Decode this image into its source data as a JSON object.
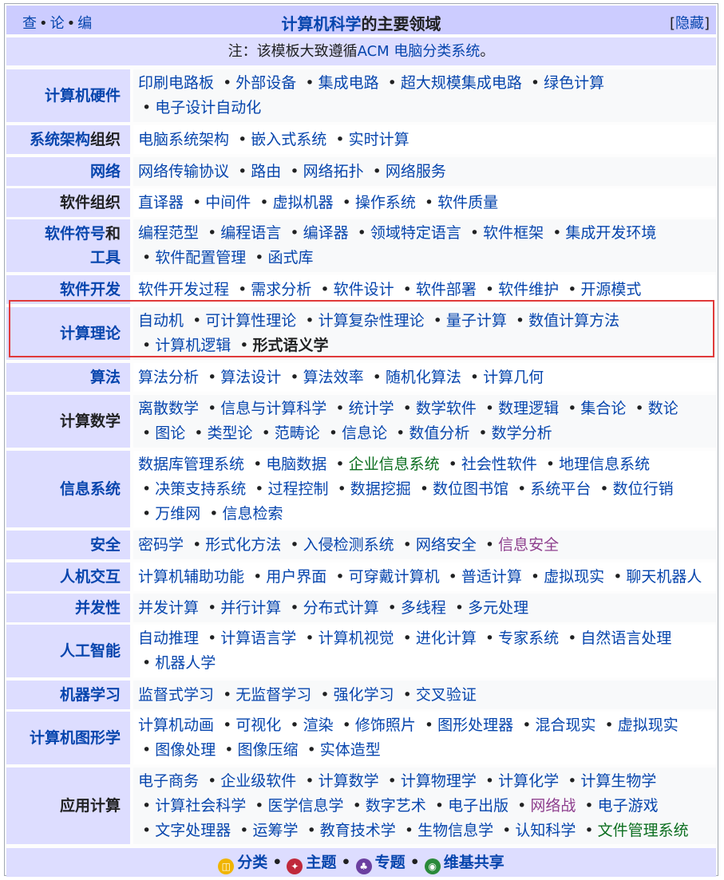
{
  "header": {
    "vte": [
      "查",
      "论",
      "编"
    ],
    "title_link": "计算机科学",
    "title_rest": "的主要领域",
    "hide_open": "[",
    "hide_label": "隐藏",
    "hide_close": "]"
  },
  "note": {
    "prefix": "注：该模板大致遵循",
    "link": "ACM 电脑分类系统",
    "suffix": "。"
  },
  "rows": [
    {
      "group": [
        {
          "t": "计算机硬件",
          "link": true
        }
      ],
      "items": [
        {
          "t": "印刷电路板"
        },
        {
          "t": "外部设备"
        },
        {
          "t": "集成电路"
        },
        {
          "t": "超大规模集成电路"
        },
        {
          "t": "绿色计算"
        },
        {
          "t": "电子设计自动化"
        }
      ]
    },
    {
      "group": [
        {
          "t": "系统架构",
          "link": true
        },
        {
          "t": "组织",
          "link": false
        }
      ],
      "items": [
        {
          "t": "电脑系统架构"
        },
        {
          "t": "嵌入式系统"
        },
        {
          "t": "实时计算"
        }
      ]
    },
    {
      "group": [
        {
          "t": "网络",
          "link": true
        }
      ],
      "items": [
        {
          "t": "网络传输协议"
        },
        {
          "t": "路由"
        },
        {
          "t": "网络拓扑"
        },
        {
          "t": "网络服务"
        }
      ]
    },
    {
      "group": [
        {
          "t": "软件组织",
          "link": false
        }
      ],
      "items": [
        {
          "t": "直译器"
        },
        {
          "t": "中间件"
        },
        {
          "t": "虚拟机器"
        },
        {
          "t": "操作系统"
        },
        {
          "t": "软件质量"
        }
      ]
    },
    {
      "group": [
        {
          "t": "软件符号",
          "link": true
        },
        {
          "t": "和",
          "link": false
        },
        {
          "t": "工具",
          "link": true
        }
      ],
      "items": [
        {
          "t": "编程范型"
        },
        {
          "t": "编程语言"
        },
        {
          "t": "编译器"
        },
        {
          "t": "领域特定语言"
        },
        {
          "t": "软件框架"
        },
        {
          "t": "集成开发环境"
        },
        {
          "t": "软件配置管理"
        },
        {
          "t": "函式库"
        }
      ]
    },
    {
      "group": [
        {
          "t": "软件开发",
          "link": true
        }
      ],
      "items": [
        {
          "t": "软件开发过程"
        },
        {
          "t": "需求分析"
        },
        {
          "t": "软件设计"
        },
        {
          "t": "软件部署"
        },
        {
          "t": "软件维护"
        },
        {
          "t": "开源模式"
        }
      ]
    },
    {
      "group": [
        {
          "t": "计算理论",
          "link": true
        }
      ],
      "items": [
        {
          "t": "自动机"
        },
        {
          "t": "可计算性理论"
        },
        {
          "t": "计算复杂性理论"
        },
        {
          "t": "量子计算"
        },
        {
          "t": "数值计算方法"
        },
        {
          "t": "计算机逻辑"
        },
        {
          "t": "形式语义学",
          "style": "self"
        }
      ]
    },
    {
      "group": [
        {
          "t": "算法",
          "link": true
        }
      ],
      "items": [
        {
          "t": "算法分析"
        },
        {
          "t": "算法设计"
        },
        {
          "t": "算法效率"
        },
        {
          "t": "随机化算法"
        },
        {
          "t": "计算几何"
        }
      ]
    },
    {
      "group": [
        {
          "t": "计算数学",
          "link": false
        }
      ],
      "items": [
        {
          "t": "离散数学"
        },
        {
          "t": "信息与计算科学"
        },
        {
          "t": "统计学"
        },
        {
          "t": "数学软件"
        },
        {
          "t": "数理逻辑"
        },
        {
          "t": "集合论"
        },
        {
          "t": "数论"
        },
        {
          "t": "图论"
        },
        {
          "t": "类型论"
        },
        {
          "t": "范畴论"
        },
        {
          "t": "信息论"
        },
        {
          "t": "数值分析"
        },
        {
          "t": "数学分析"
        }
      ]
    },
    {
      "group": [
        {
          "t": "信息系统",
          "link": true
        }
      ],
      "items": [
        {
          "t": "数据库管理系统"
        },
        {
          "t": "电脑数据"
        },
        {
          "t": "企业信息系统",
          "style": "green"
        },
        {
          "t": "社会性软件"
        },
        {
          "t": "地理信息系统"
        },
        {
          "t": "决策支持系统"
        },
        {
          "t": "过程控制"
        },
        {
          "t": "数据挖掘"
        },
        {
          "t": "数位图书馆"
        },
        {
          "t": "系统平台"
        },
        {
          "t": "数位行销"
        },
        {
          "t": "万维网"
        },
        {
          "t": "信息检索"
        }
      ]
    },
    {
      "group": [
        {
          "t": "安全",
          "link": true
        }
      ],
      "items": [
        {
          "t": "密码学"
        },
        {
          "t": "形式化方法"
        },
        {
          "t": "入侵检测系统"
        },
        {
          "t": "网络安全"
        },
        {
          "t": "信息安全",
          "style": "visited"
        }
      ]
    },
    {
      "group": [
        {
          "t": "人机交互",
          "link": true
        }
      ],
      "items": [
        {
          "t": "计算机辅助功能"
        },
        {
          "t": "用户界面"
        },
        {
          "t": "可穿戴计算机"
        },
        {
          "t": "普适计算"
        },
        {
          "t": "虚拟现实"
        },
        {
          "t": "聊天机器人"
        }
      ]
    },
    {
      "group": [
        {
          "t": "并发性",
          "link": true
        }
      ],
      "items": [
        {
          "t": "并发计算"
        },
        {
          "t": "并行计算"
        },
        {
          "t": "分布式计算"
        },
        {
          "t": "多线程"
        },
        {
          "t": "多元处理"
        }
      ]
    },
    {
      "group": [
        {
          "t": "人工智能",
          "link": true
        }
      ],
      "items": [
        {
          "t": "自动推理"
        },
        {
          "t": "计算语言学"
        },
        {
          "t": "计算机视觉"
        },
        {
          "t": "进化计算"
        },
        {
          "t": "专家系统"
        },
        {
          "t": "自然语言处理"
        },
        {
          "t": "机器人学"
        }
      ]
    },
    {
      "group": [
        {
          "t": "机器学习",
          "link": true
        }
      ],
      "items": [
        {
          "t": "监督式学习"
        },
        {
          "t": "无监督学习"
        },
        {
          "t": "强化学习"
        },
        {
          "t": "交叉验证"
        }
      ]
    },
    {
      "group": [
        {
          "t": "计算机图形学",
          "link": true
        }
      ],
      "items": [
        {
          "t": "计算机动画"
        },
        {
          "t": "可视化"
        },
        {
          "t": "渲染"
        },
        {
          "t": "修饰照片"
        },
        {
          "t": "图形处理器"
        },
        {
          "t": "混合现实"
        },
        {
          "t": "虚拟现实"
        },
        {
          "t": "图像处理"
        },
        {
          "t": "图像压缩"
        },
        {
          "t": "实体造型"
        }
      ]
    },
    {
      "group": [
        {
          "t": "应用计算",
          "link": false
        }
      ],
      "items": [
        {
          "t": "电子商务"
        },
        {
          "t": "企业级软件"
        },
        {
          "t": "计算数学"
        },
        {
          "t": "计算物理学"
        },
        {
          "t": "计算化学"
        },
        {
          "t": "计算生物学"
        },
        {
          "t": "计算社会科学"
        },
        {
          "t": "医学信息学"
        },
        {
          "t": "数字艺术"
        },
        {
          "t": "电子出版"
        },
        {
          "t": "网络战",
          "style": "visited"
        },
        {
          "t": "电子游戏"
        },
        {
          "t": "文字处理器"
        },
        {
          "t": "运筹学"
        },
        {
          "t": "教育技术学"
        },
        {
          "t": "生物信息学"
        },
        {
          "t": "认知科学"
        },
        {
          "t": "文件管理系统",
          "style": "green"
        }
      ]
    }
  ],
  "footer": [
    {
      "label": "分类",
      "icon": "category-icon",
      "color": "#f0b400"
    },
    {
      "label": "主题",
      "icon": "topic-icon",
      "color": "#c0293b"
    },
    {
      "label": "专题",
      "icon": "wikiproject-icon",
      "color": "#6b3fa0"
    },
    {
      "label": "维基共享",
      "icon": "commons-icon",
      "color": "#2a8a3a"
    }
  ],
  "colors": {
    "link": "#0645ad",
    "group_bg": "#ddddff",
    "title_bg": "#ccccff",
    "highlight": "#e03a3a"
  }
}
